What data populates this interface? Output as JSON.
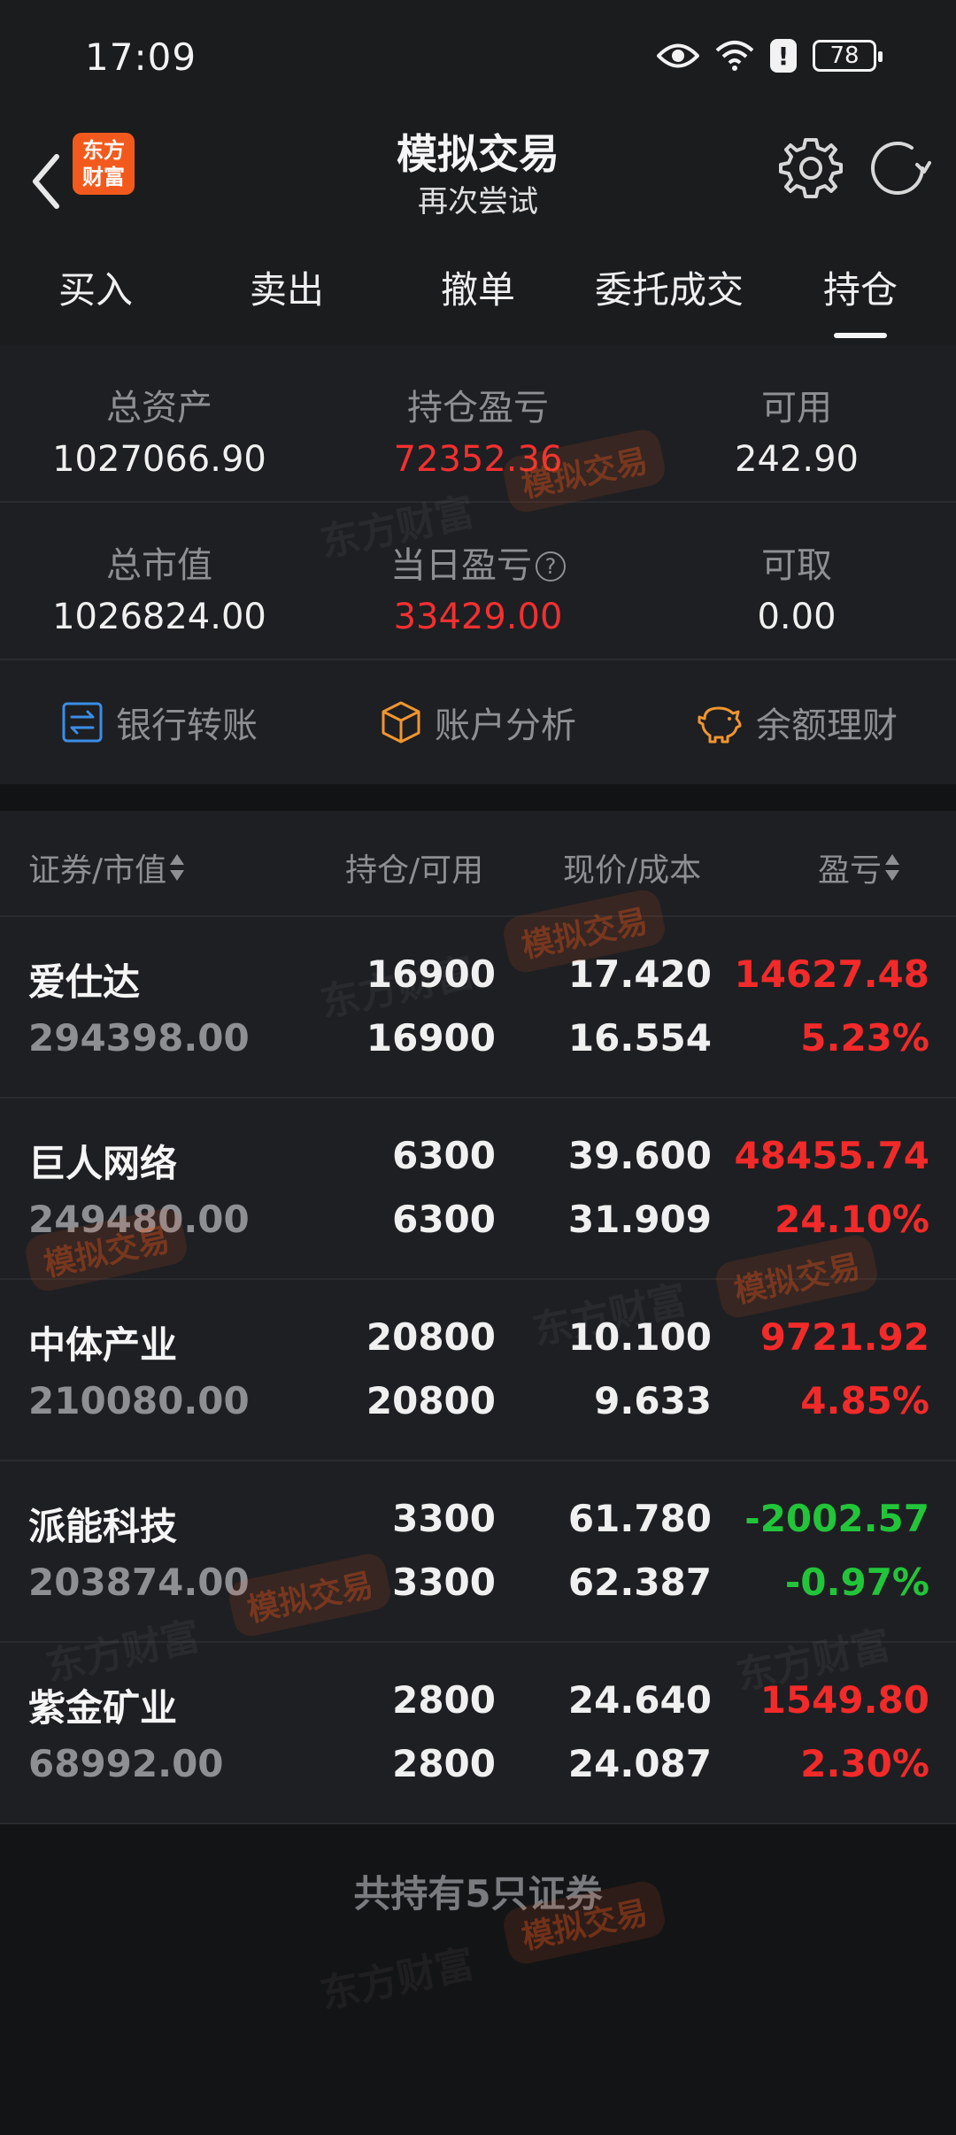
{
  "status_bar": {
    "time": "17:09",
    "battery": "78",
    "icons": [
      "eye-icon",
      "wifi-icon",
      "alert-icon",
      "battery-icon"
    ]
  },
  "header": {
    "logo_line1": "东方",
    "logo_line2": "财富",
    "title": "模拟交易",
    "subtitle": "再次尝试"
  },
  "tabs": [
    {
      "label": "买入"
    },
    {
      "label": "卖出"
    },
    {
      "label": "撤单"
    },
    {
      "label": "委托成交"
    },
    {
      "label": "持仓",
      "active": true
    }
  ],
  "summary": {
    "total_assets_label": "总资产",
    "total_assets": "1027066.90",
    "position_pnl_label": "持仓盈亏",
    "position_pnl": "72352.36",
    "available_label": "可用",
    "available": "242.90",
    "market_value_label": "总市值",
    "market_value": "1026824.00",
    "daily_pnl_label": "当日盈亏",
    "daily_pnl": "33429.00",
    "withdrawable_label": "可取",
    "withdrawable": "0.00"
  },
  "actions": {
    "bank_transfer": "银行转账",
    "account_analysis": "账户分析",
    "wealth_mgmt": "余额理财"
  },
  "table": {
    "col_security": "证券/市值",
    "col_position": "持仓/可用",
    "col_price": "现价/成本",
    "col_pnl": "盈亏",
    "rows": [
      {
        "name": "爱仕达",
        "market_value": "294398.00",
        "position": "16900",
        "available": "16900",
        "price": "17.420",
        "cost": "16.554",
        "pnl": "14627.48",
        "pnl_pct": "5.23%",
        "direction": "up"
      },
      {
        "name": "巨人网络",
        "market_value": "249480.00",
        "position": "6300",
        "available": "6300",
        "price": "39.600",
        "cost": "31.909",
        "pnl": "48455.74",
        "pnl_pct": "24.10%",
        "direction": "up"
      },
      {
        "name": "中体产业",
        "market_value": "210080.00",
        "position": "20800",
        "available": "20800",
        "price": "10.100",
        "cost": "9.633",
        "pnl": "9721.92",
        "pnl_pct": "4.85%",
        "direction": "up"
      },
      {
        "name": "派能科技",
        "market_value": "203874.00",
        "position": "3300",
        "available": "3300",
        "price": "61.780",
        "cost": "62.387",
        "pnl": "-2002.57",
        "pnl_pct": "-0.97%",
        "direction": "down"
      },
      {
        "name": "紫金矿业",
        "market_value": "68992.00",
        "position": "2800",
        "available": "2800",
        "price": "24.640",
        "cost": "24.087",
        "pnl": "1549.80",
        "pnl_pct": "2.30%",
        "direction": "up"
      }
    ]
  },
  "footer": {
    "holdings_count": "共持有5只证券"
  },
  "watermark": {
    "brand": "东方财富",
    "tag": "模拟交易"
  },
  "colors": {
    "up": "#f22a2a",
    "down": "#22c53a",
    "brand": "#f25a1d"
  }
}
